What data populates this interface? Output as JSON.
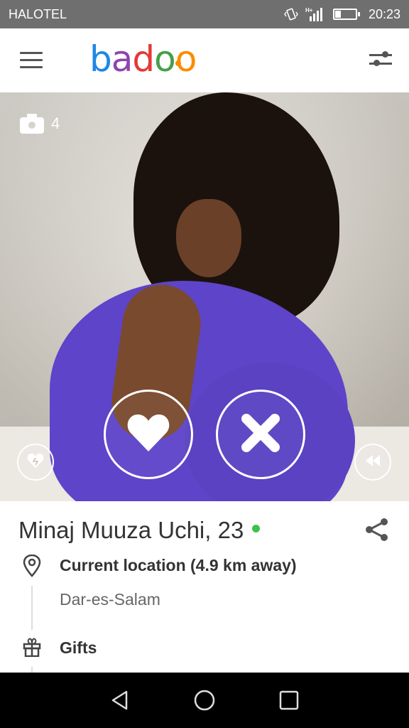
{
  "status_bar": {
    "carrier": "HALOTEL",
    "time": "20:23",
    "signal_label": "H+",
    "icons": [
      "vibrate-icon",
      "signal-icon",
      "battery-icon"
    ]
  },
  "app_bar": {
    "logo_text": "badoo",
    "logo_colors": [
      "#1e88e5",
      "#8e44ad",
      "#e53935",
      "#43a047",
      "#fb8c00"
    ],
    "menu_icon": "hamburger-menu-icon",
    "filter_icon": "filter-sliders-icon"
  },
  "photo": {
    "photo_count": "4",
    "camera_icon": "camera-icon",
    "like_icon": "heart-icon",
    "pass_icon": "x-icon",
    "crush_icon": "heart-crush-icon",
    "undo_icon": "rewind-icon"
  },
  "profile": {
    "name_age": "Minaj Muuza Uchi, 23",
    "online": true,
    "online_color": "#3ec24a",
    "location_title": "Current location (4.9 km away)",
    "location_value": "Dar-es-Salam",
    "gifts_title": "Gifts"
  },
  "nav_bar": {
    "buttons": [
      "back-icon",
      "home-icon",
      "recents-icon"
    ]
  }
}
